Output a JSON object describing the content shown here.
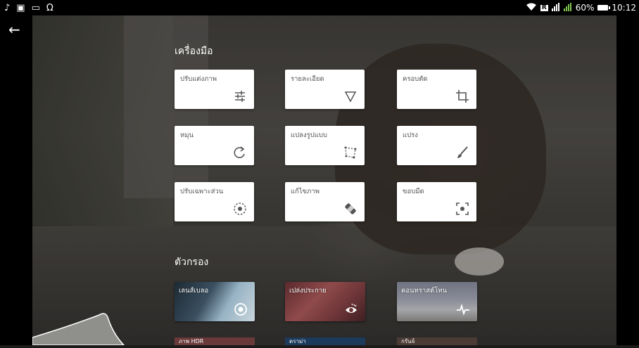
{
  "status_bar": {
    "left_icons": [
      "music-note-icon",
      "photo-icon",
      "gallery-icon",
      "headset-icon"
    ],
    "network_label": "R",
    "battery_percent": "60%",
    "time": "10:12"
  },
  "tools": {
    "section_title": "เครื่องมือ",
    "items": [
      {
        "label": "ปรับแต่งภาพ",
        "icon": "tune-sliders-icon"
      },
      {
        "label": "รายละเอียด",
        "icon": "details-triangle-icon"
      },
      {
        "label": "ครอบตัด",
        "icon": "crop-icon"
      },
      {
        "label": "หมุน",
        "icon": "rotate-icon"
      },
      {
        "label": "แปลงรูปแบบ",
        "icon": "perspective-icon"
      },
      {
        "label": "แปรง",
        "icon": "brush-icon"
      },
      {
        "label": "ปรับเฉพาะส่วน",
        "icon": "selective-target-icon"
      },
      {
        "label": "แก้ไขภาพ",
        "icon": "healing-bandage-icon"
      },
      {
        "label": "ขอบมืด",
        "icon": "vignette-icon"
      }
    ]
  },
  "filters": {
    "section_title": "ตัวกรอง",
    "items": [
      {
        "label": "เลนส์เบลอ",
        "icon": "lens-blur-icon"
      },
      {
        "label": "เปล่งประกาย",
        "icon": "glamour-glow-icon"
      },
      {
        "label": "คอนทราสต์โทน",
        "icon": "tonal-pulse-icon"
      }
    ],
    "peek_items": [
      {
        "label": "ภาพ HDR"
      },
      {
        "label": "ดราม่า"
      },
      {
        "label": "กรันจ์"
      }
    ]
  }
}
